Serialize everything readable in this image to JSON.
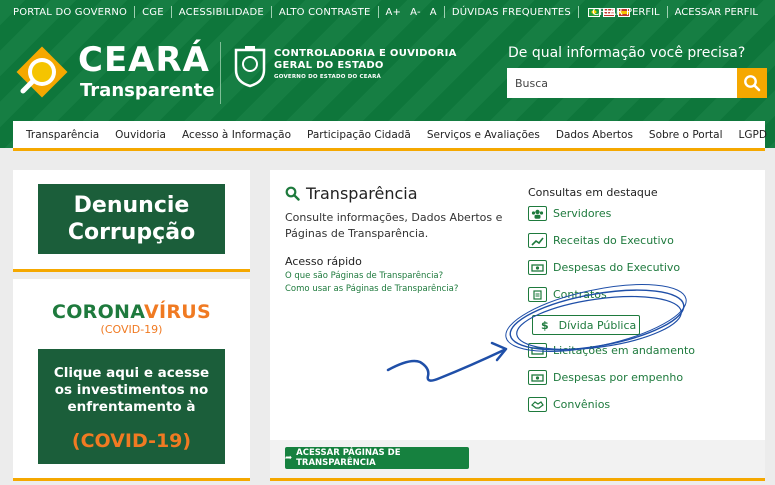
{
  "topbar": {
    "links": [
      "PORTAL DO GOVERNO",
      "CGE",
      "ACESSIBILIDADE",
      "ALTO CONTRASTE",
      "A+",
      "A-",
      "A",
      "DÚVIDAS FREQUENTES"
    ],
    "right": [
      "CRIAR PERFIL",
      "ACESSAR PERFIL"
    ]
  },
  "logo": {
    "title": "CEARÁ",
    "subtitle": "Transparente"
  },
  "cge": {
    "line1": "CONTROLADORIA E OUVIDORIA",
    "line2": "GERAL DO ESTADO",
    "line3": "GOVERNO DO ESTADO DO CEARÁ"
  },
  "search": {
    "question": "De qual informação você precisa?",
    "placeholder": "Busca"
  },
  "nav": [
    "Transparência",
    "Ouvidoria",
    "Acesso à Informação",
    "Participação Cidadã",
    "Serviços e Avaliações",
    "Dados Abertos",
    "Sobre o Portal",
    "LGPD"
  ],
  "denuncie": {
    "line1": "Denuncie",
    "line2": "Corrupção"
  },
  "corona": {
    "title_a": "CORONA",
    "title_b": "VÍRUS",
    "sub": "(COVID-19)",
    "body": [
      "Clique aqui e acesse",
      "os investimentos no",
      "enfrentamento à"
    ],
    "cta": "(COVID-19)"
  },
  "main": {
    "title": "Transparência",
    "desc": "Consulte informações, Dados Abertos e Páginas de Transparência.",
    "quick_title": "Acesso rápido",
    "quick_links": [
      "O que são Páginas de Transparência?",
      "Como usar as Páginas de Transparência?"
    ],
    "featured_title": "Consultas em destaque",
    "featured": [
      "Servidores",
      "Receitas do Executivo",
      "Despesas do Executivo",
      "Contratos",
      "Dívida Pública",
      "Licitações em andamento",
      "Despesas por empenho",
      "Convênios"
    ],
    "access_button": "ACESSAR PÁGINAS DE TRANSPARÊNCIA"
  },
  "colors": {
    "green": "#0e7a3d",
    "accent": "#f5a800",
    "dark_green": "#1b5e3a",
    "orange": "#f07a22"
  }
}
